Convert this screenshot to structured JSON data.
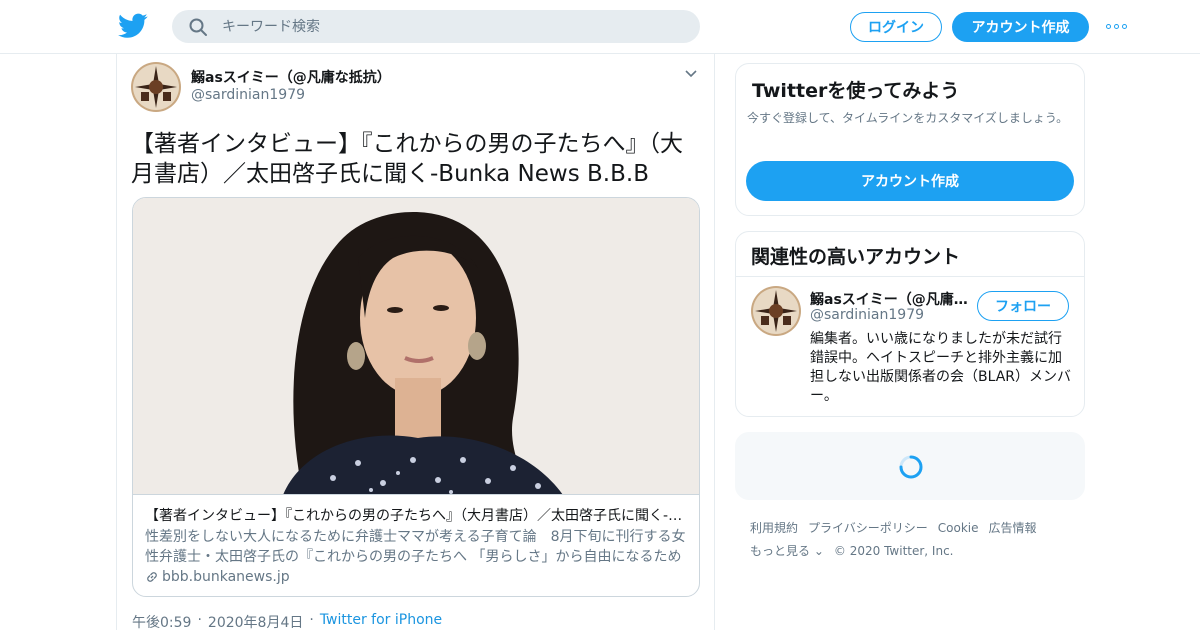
{
  "header": {
    "search_placeholder": "キーワード検索",
    "login_label": "ログイン",
    "signup_label": "アカウント作成"
  },
  "tweet": {
    "author_name": "鰯asスイミー（@凡庸な抵抗）",
    "author_handle": "@sardinian1979",
    "text": "【著者インタビュー】『これからの男の子たちへ』（大月書店）／太田啓子氏に聞く-Bunka News B.B.B",
    "card": {
      "title": "【著者インタビュー】『これからの男の子たちへ』（大月書店）／太田啓子氏に聞く-Bunka News B.B.B",
      "description": "性差別をしない大人になるために弁護士ママが考える子育て論　8月下旬に刊行する女性弁護士・太田啓子氏の『これからの男の子たちへ 「男らしさ」から自由になるためのレッスン』",
      "domain": "bbb.bunkanews.jp"
    },
    "time": "午後0:59",
    "date": "2020年8月4日",
    "source": "Twitter for iPhone"
  },
  "sidebar": {
    "try_title": "Twitterを使ってみよう",
    "try_desc": "今すぐ登録して、タイムラインをカスタマイズしましょう。",
    "try_button": "アカウント作成",
    "related_title": "関連性の高いアカウント",
    "related": {
      "name": "鰯asスイミー（@凡庸な抵抗）",
      "handle": "@sardinian1979",
      "follow_label": "フォロー",
      "bio": "編集者。いい歳になりましたが未だ試行錯誤中。ヘイトスピーチと排外主義に加担しない出版関係者の会（BLAR）メンバー。"
    }
  },
  "footer": {
    "links": [
      "利用規約",
      "プライバシーポリシー",
      "Cookie",
      "広告情報"
    ],
    "more": "もっと見る",
    "copyright": "© 2020 Twitter, Inc."
  },
  "colors": {
    "accent": "#1da1f2",
    "secondary_text": "#657786",
    "border": "#e6ecf0"
  }
}
